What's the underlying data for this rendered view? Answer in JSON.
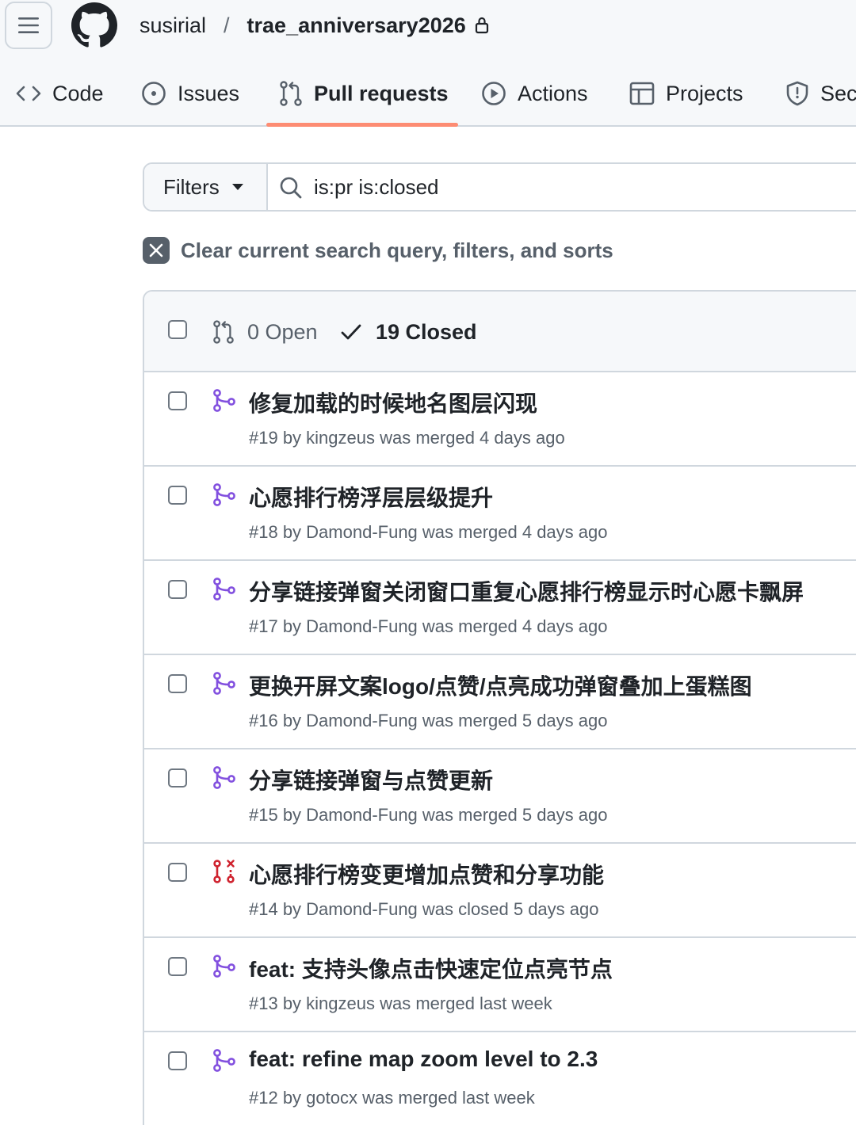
{
  "header": {
    "owner": "susirial",
    "separator": "/",
    "repo": "trae_anniversary2026"
  },
  "tabs": [
    {
      "label": "Code",
      "icon": "code-icon"
    },
    {
      "label": "Issues",
      "icon": "issue-opened-icon"
    },
    {
      "label": "Pull requests",
      "icon": "git-pull-request-icon",
      "active": true
    },
    {
      "label": "Actions",
      "icon": "play-icon"
    },
    {
      "label": "Projects",
      "icon": "table-icon"
    },
    {
      "label": "Sec",
      "icon": "shield-icon"
    }
  ],
  "filter_bar": {
    "filters_label": "Filters",
    "search_value": "is:pr is:closed"
  },
  "clear_filters": {
    "label": "Clear current search query, filters, and sorts"
  },
  "list_header": {
    "open_label": "0 Open",
    "closed_label": "19 Closed"
  },
  "pull_requests": [
    {
      "title": "修复加载的时候地名图层闪现",
      "meta": "#19 by kingzeus was merged 4 days ago",
      "state": "merged"
    },
    {
      "title": "心愿排行榜浮层层级提升",
      "meta": "#18 by Damond-Fung was merged 4 days ago",
      "state": "merged"
    },
    {
      "title": "分享链接弹窗关闭窗口重复心愿排行榜显示时心愿卡飘屏",
      "meta": "#17 by Damond-Fung was merged 4 days ago",
      "state": "merged"
    },
    {
      "title": "更换开屏文案logo/点赞/点亮成功弹窗叠加上蛋糕图",
      "meta": "#16 by Damond-Fung was merged 5 days ago",
      "state": "merged"
    },
    {
      "title": "分享链接弹窗与点赞更新",
      "meta": "#15 by Damond-Fung was merged 5 days ago",
      "state": "merged"
    },
    {
      "title": "心愿排行榜变更增加点赞和分享功能",
      "meta": "#14 by Damond-Fung was closed 5 days ago",
      "state": "closed"
    },
    {
      "title": "feat: 支持头像点击快速定位点亮节点",
      "meta": "#13 by kingzeus was merged last week",
      "state": "merged"
    },
    {
      "title": "feat: refine map zoom level to 2.3",
      "meta": "#12 by gotocx was merged last week",
      "state": "merged"
    }
  ],
  "colors": {
    "merged": "#8250df",
    "closed": "#cf222e",
    "active_tab_underline": "#fd8c73"
  }
}
